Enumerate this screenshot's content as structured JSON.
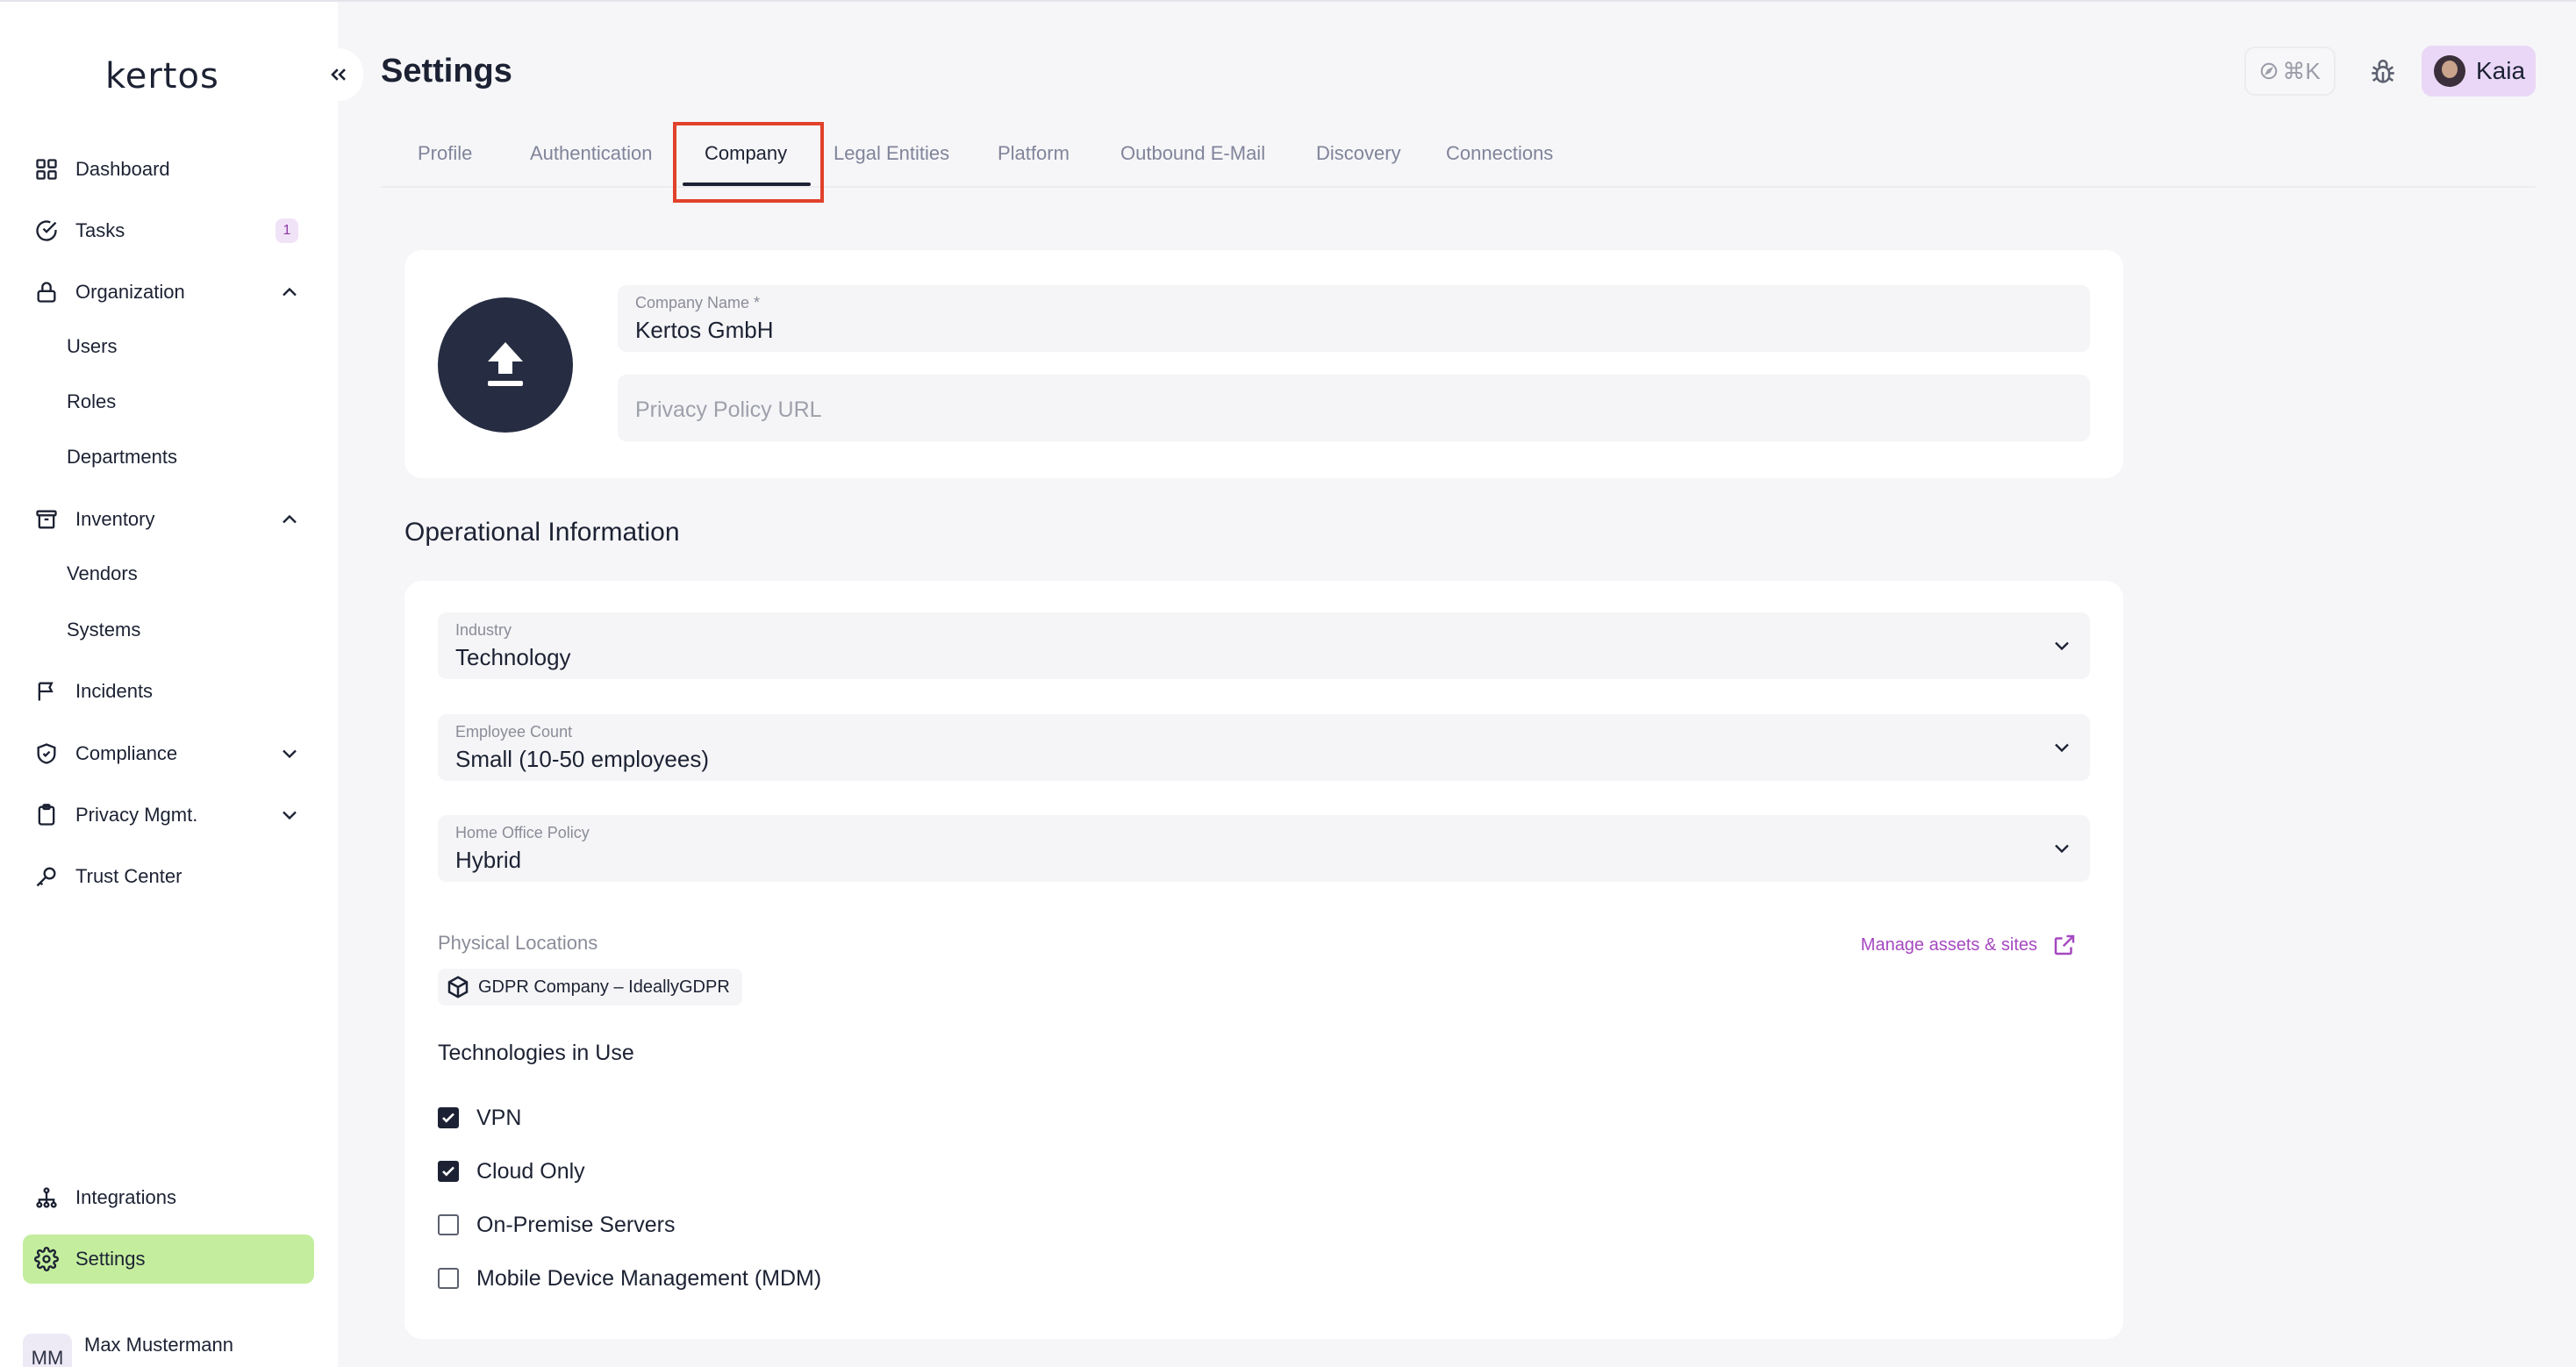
{
  "app": {
    "logo": "kertos",
    "page_title": "Settings"
  },
  "sidebar": {
    "items": [
      {
        "label": "Dashboard",
        "icon": "grid-icon"
      },
      {
        "label": "Tasks",
        "icon": "check-circle-icon",
        "badge": "1"
      },
      {
        "label": "Organization",
        "icon": "lock-icon",
        "expanded": true,
        "children": [
          "Users",
          "Roles",
          "Departments"
        ]
      },
      {
        "label": "Inventory",
        "icon": "archive-icon",
        "expanded": true,
        "children": [
          "Vendors",
          "Systems"
        ]
      },
      {
        "label": "Incidents",
        "icon": "flag-icon"
      },
      {
        "label": "Compliance",
        "icon": "shield-check-icon",
        "expanded": false
      },
      {
        "label": "Privacy Mgmt.",
        "icon": "clipboard-icon",
        "expanded": false
      },
      {
        "label": "Trust Center",
        "icon": "key-icon"
      }
    ],
    "bottom_items": [
      {
        "label": "Integrations",
        "icon": "network-icon"
      },
      {
        "label": "Settings",
        "icon": "gear-icon",
        "active": true
      }
    ],
    "user": {
      "initials": "MM",
      "name": "Max Mustermann"
    }
  },
  "header": {
    "shortcut": "⌘K",
    "user_chip_name": "Kaia"
  },
  "tabs": [
    "Profile",
    "Authentication",
    "Company",
    "Legal Entities",
    "Platform",
    "Outbound E-Mail",
    "Discovery",
    "Connections"
  ],
  "active_tab": "Company",
  "company": {
    "name_label": "Company Name *",
    "name_value": "Kertos GmbH",
    "privacy_placeholder": "Privacy Policy URL"
  },
  "operational": {
    "section_title": "Operational Information",
    "industry": {
      "label": "Industry",
      "value": "Technology"
    },
    "employee_count": {
      "label": "Employee Count",
      "value": "Small (10-50 employees)"
    },
    "home_office": {
      "label": "Home Office Policy",
      "value": "Hybrid"
    },
    "physical_locations_label": "Physical Locations",
    "manage_link": "Manage assets & sites",
    "location_chip": "GDPR Company – IdeallyGDPR",
    "technologies_title": "Technologies in Use",
    "technologies": [
      {
        "label": "VPN",
        "checked": true
      },
      {
        "label": "Cloud Only",
        "checked": true
      },
      {
        "label": "On-Premise Servers",
        "checked": false
      },
      {
        "label": "Mobile Device Management (MDM)",
        "checked": false
      }
    ]
  },
  "colors": {
    "active_nav_bg": "#c4ee9e",
    "accent_link": "#a548c0",
    "highlight_border": "#e1412b",
    "dark": "#262d42"
  }
}
